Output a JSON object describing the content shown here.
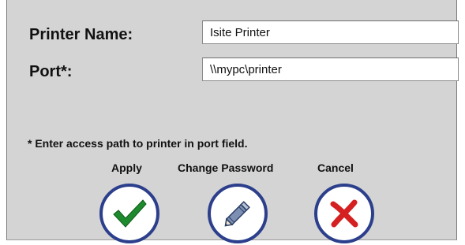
{
  "form": {
    "printer_name_label": "Printer Name:",
    "printer_name_value": "Isite Printer",
    "port_label": "Port*:",
    "port_value": "\\\\mypc\\printer"
  },
  "note": "* Enter access path to printer in port field.",
  "buttons": {
    "apply_label": "Apply",
    "change_password_label": "Change Password",
    "cancel_label": "Cancel"
  },
  "icons": {
    "apply": "checkmark-icon",
    "change_password": "pencil-icon",
    "cancel": "x-icon"
  },
  "colors": {
    "dialog_bg": "#d4d4d4",
    "button_ring": "#2c3f8c",
    "check_green": "#1e8a2e",
    "cancel_red": "#d42020"
  }
}
